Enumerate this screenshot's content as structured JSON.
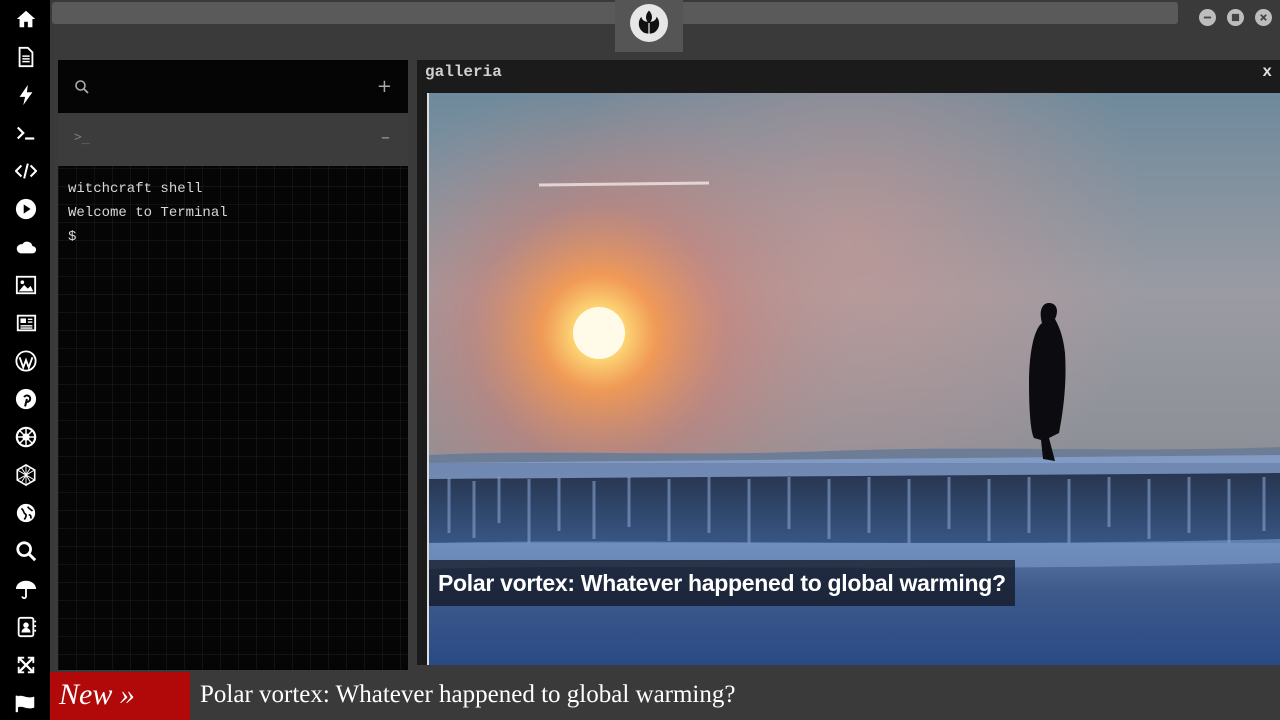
{
  "sidebar": {
    "icons": [
      "home-icon",
      "document-icon",
      "bolt-icon",
      "terminal-icon",
      "code-icon",
      "play-icon",
      "cloud-icon",
      "image-icon",
      "newspaper-icon",
      "wordpress-icon",
      "pinterest-icon",
      "rebel-icon",
      "network-icon",
      "globe-icon",
      "search-icon",
      "umbrella-icon",
      "contacts-icon",
      "expand-icon",
      "flag-icon"
    ]
  },
  "window_controls": [
    "minimize-icon",
    "maximize-icon",
    "close-icon"
  ],
  "terminal": {
    "search_icon": "search-icon",
    "add_symbol": "+",
    "tab_prompt": ">_",
    "collapse_symbol": "–",
    "lines": [
      "witchcraft shell",
      "Welcome to Terminal",
      "$"
    ]
  },
  "gallery": {
    "title": "galleria",
    "close_label": "x",
    "caption": "Polar vortex: Whatever happened to global warming?"
  },
  "ticker": {
    "badge": "New »",
    "headline": "Polar vortex: Whatever happened to global warming?"
  },
  "colors": {
    "sidebar_bg": "#000000",
    "chrome_bg": "#3a3a3a",
    "ticker_badge": "#b10909",
    "terminal_bg": "#050505"
  }
}
